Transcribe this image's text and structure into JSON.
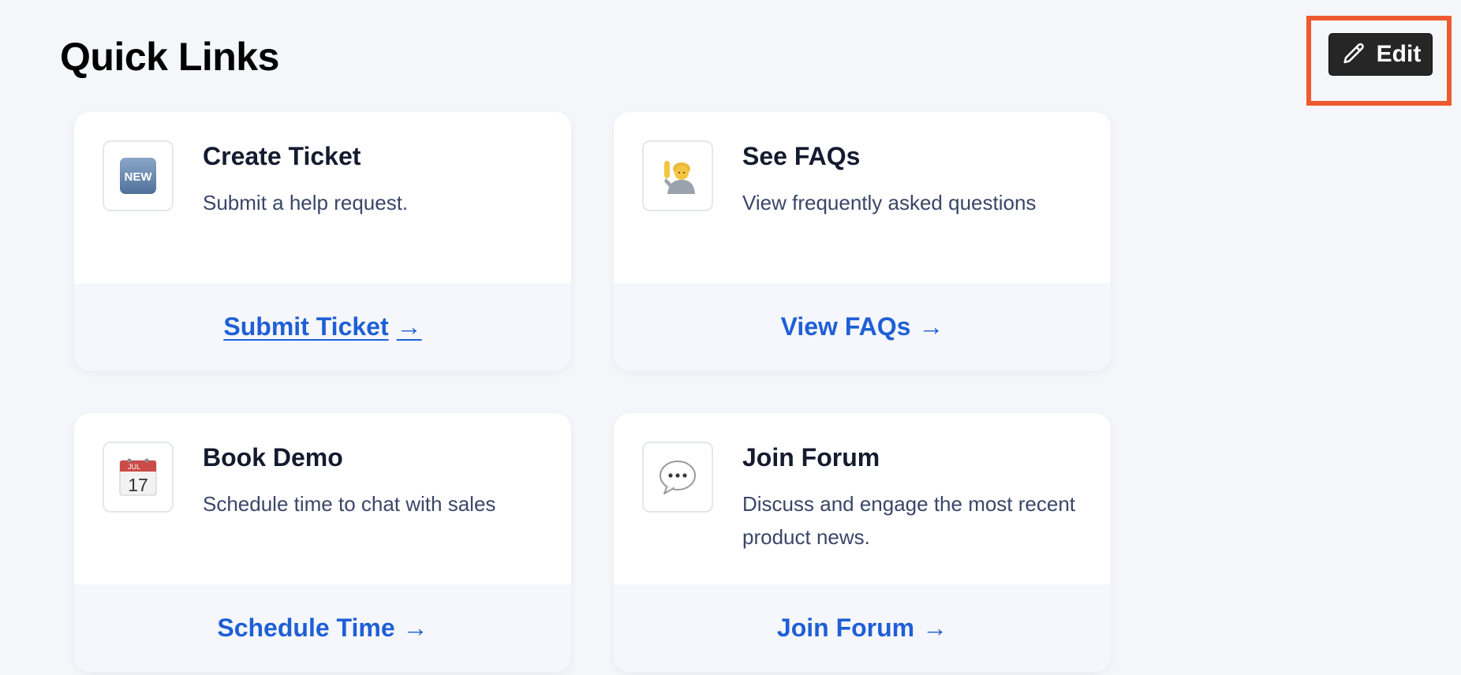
{
  "page": {
    "title": "Quick Links",
    "background": "#f4f6fa"
  },
  "edit_button": {
    "label": "Edit",
    "icon": "pencil-icon",
    "highlight_color": "#ee5a2f"
  },
  "colors": {
    "link": "#1f5fd6",
    "title": "#141b2e",
    "description": "#3a4668",
    "footer": "#f5f7fc"
  },
  "cards": [
    {
      "title": "Create Ticket",
      "description": "Submit a help request.",
      "icon": "new-badge-icon",
      "link": "Submit Ticket",
      "link_arrow": "→",
      "link_underlined": true
    },
    {
      "title": "See FAQs",
      "description": "View frequently asked questions",
      "icon": "person-raising-hand-icon",
      "link": "View FAQs",
      "link_arrow": "→",
      "link_underlined": false
    },
    {
      "title": "Book Demo",
      "description": "Schedule time to chat with sales",
      "icon": "calendar-icon",
      "calendar_month": "JUL",
      "calendar_day": "17",
      "link": "Schedule Time",
      "link_arrow": "→",
      "link_underlined": false
    },
    {
      "title": "Join Forum",
      "description": "Discuss and engage the most recent product news.",
      "icon": "speech-bubble-icon",
      "link": "Join Forum",
      "link_arrow": "→",
      "link_underlined": false
    }
  ]
}
